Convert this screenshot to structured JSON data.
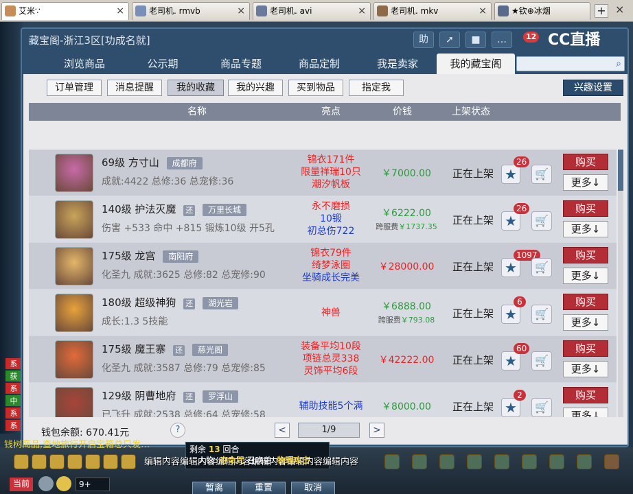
{
  "browser_tabs": [
    {
      "title": "艾米∵",
      "active": true
    },
    {
      "title": "老司机. rmvb",
      "active": false
    },
    {
      "title": "老司机. avi",
      "active": false
    },
    {
      "title": "老司机. mkv",
      "active": false
    },
    {
      "title": "★钦⊕冰烟",
      "active": false
    }
  ],
  "window": {
    "title": "藏宝阁-浙江3区[功成名就]",
    "btn_help": "助",
    "cc": {
      "count": "12",
      "label": "CC直播"
    }
  },
  "nav_tabs": [
    "浏览商品",
    "公示期",
    "商品专题",
    "商品定制",
    "我是卖家",
    "我的藏宝阁"
  ],
  "sub_tabs": [
    "订单管理",
    "消息提醒",
    "我的收藏",
    "我的兴趣",
    "买到物品",
    "指定我"
  ],
  "interest_btn": "兴趣设置",
  "table_headers": {
    "name": "名称",
    "highlight": "亮点",
    "price": "价钱",
    "status": "上架状态"
  },
  "rows": [
    {
      "level": "69级",
      "school": "方寸山",
      "huan": "",
      "server": "成都府",
      "sub": "成就:4422 总修:36 总宠修:36",
      "highlights": [
        "锦衣171件",
        "限量祥瑞10只",
        "潮汐帆板"
      ],
      "highlight_colors": [
        "#e22",
        "#e22",
        "#e22"
      ],
      "price": "￥7000.00",
      "price_color": "green",
      "cross_price": "",
      "status": "正在上架",
      "fav": "26",
      "avatar_color": "#c86aa8"
    },
    {
      "level": "140级",
      "school": "护法灭魔",
      "huan": "还",
      "server": "万里长城",
      "sub": "伤害 +533 命中 +815 锻炼10级 开5孔",
      "highlights": [
        "永不磨损",
        "10锻",
        "初总伤722"
      ],
      "highlight_colors": [
        "#e22",
        "#1a3ad6",
        "#1a3ad6"
      ],
      "price": "￥6222.00",
      "price_color": "green",
      "cross_price": "￥1737.35",
      "cross_label": "跨服费",
      "status": "正在上架",
      "fav": "26",
      "avatar_color": "#c9a45a"
    },
    {
      "level": "175级",
      "school": "龙宫",
      "huan": "",
      "server": "南阳府",
      "sub": "化圣九 成就:3625 总修:82 总宠修:90",
      "highlights": [
        "锦衣79件",
        "绮梦泳圈",
        "坐骑成长完美"
      ],
      "highlight_colors": [
        "#e22",
        "#e22",
        "#1a3ad6"
      ],
      "price": "￥28000.00",
      "price_color": "red",
      "cross_price": "",
      "status": "正在上架",
      "fav": "1097",
      "avatar_color": "#e4b66a"
    },
    {
      "level": "180级",
      "school": "超级神狗",
      "huan": "还",
      "server": "湖光岩",
      "sub": "成长:1.3 5技能",
      "highlights": [
        "神兽"
      ],
      "highlight_colors": [
        "#e22"
      ],
      "price": "￥6888.00",
      "price_color": "green",
      "cross_price": "￥793.08",
      "cross_label": "跨服费",
      "status": "正在上架",
      "fav": "6",
      "avatar_color": "#e8a23a"
    },
    {
      "level": "175级",
      "school": "魔王寨",
      "huan": "还",
      "server": "慈光阁",
      "sub": "化圣九 成就:3587 总修:79 总宠修:85",
      "highlights": [
        "装备平均10段",
        "项链总灵338",
        "灵饰平均6段"
      ],
      "highlight_colors": [
        "#e22",
        "#e22",
        "#e22"
      ],
      "price": "￥42222.00",
      "price_color": "red",
      "cross_price": "",
      "status": "正在上架",
      "fav": "60",
      "avatar_color": "#e26a3a"
    },
    {
      "level": "129级",
      "school": "阴曹地府",
      "huan": "还",
      "server": "罗浮山",
      "sub": "已飞升 成就:2538 总修:64 总宠修:58",
      "highlights": [
        "辅助技能5个满"
      ],
      "highlight_colors": [
        "#1a3ad6"
      ],
      "price": "￥8000.00",
      "price_color": "green",
      "cross_price": "",
      "status": "正在上架",
      "fav": "2",
      "avatar_color": "#a8443a"
    }
  ],
  "buy_label": "购买",
  "more_label": "更多↓",
  "footer": {
    "balance": "钱包余额: 670.41元",
    "help": "?",
    "page": "1/9",
    "prev": "<",
    "next": ">"
  },
  "hud": {
    "remain_prefix": "剩余",
    "remain_num": "13",
    "remain_suffix": "回合",
    "person_label": "人物:",
    "person_val": "夺命咒",
    "summon_label": "召唤兽:",
    "summon_val": "物理攻击",
    "btn_pause": "暂离",
    "btn_reset": "重置",
    "btn_cancel": "取消",
    "marquee": "编辑内容编辑内容编辑内容编辑内容编辑内容编辑内容",
    "chat": "钱树商品,查地旅行开启宝箱总只发…",
    "channel": "当前",
    "input": "9+"
  },
  "colors": {
    "accent": "#2f4d6c",
    "buy": "#b22d35",
    "price_red": "#e22",
    "price_green": "#2a9a3a"
  }
}
